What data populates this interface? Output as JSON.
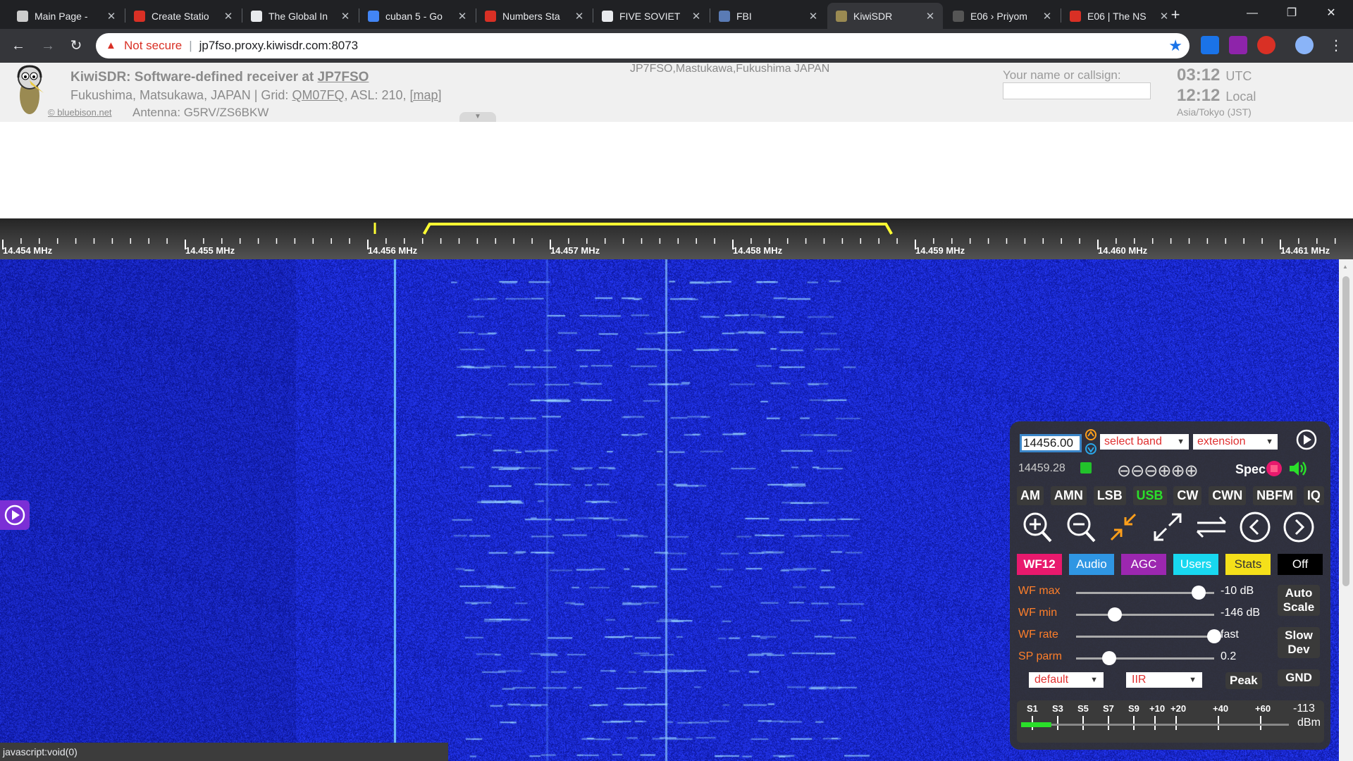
{
  "browser": {
    "tabs": [
      {
        "title": "Main Page - ",
        "icon": "wiki-icon"
      },
      {
        "title": "Create Statio",
        "icon": "numbers-station-icon"
      },
      {
        "title": "The Global In",
        "icon": "document-icon"
      },
      {
        "title": "cuban 5 - Go",
        "icon": "google-icon"
      },
      {
        "title": "Numbers Sta",
        "icon": "numbers-station-icon"
      },
      {
        "title": "FIVE SOVIET",
        "icon": "lock-icon"
      },
      {
        "title": "FBI",
        "icon": "fbi-seal-icon"
      },
      {
        "title": "KiwiSDR",
        "icon": "kiwi-icon",
        "active": true
      },
      {
        "title": "E06 › Priyom",
        "icon": "priyom-icon"
      },
      {
        "title": "E06 | The NS",
        "icon": "numbers-station-icon"
      }
    ],
    "not_secure_label": "Not secure",
    "url": "jp7fso.proxy.kiwisdr.com:8073",
    "status_text": "javascript:void(0)"
  },
  "kiwi": {
    "title_prefix": "KiwiSDR: Software-defined receiver at ",
    "title_callsign": "JP7FSO",
    "location_prefix": "Fukushima, Matsukawa, JAPAN | Grid: ",
    "grid": "QM07FQ",
    "asl_text": ", ASL: 210, ",
    "map_link": "[map]",
    "copyright": "© bluebison.net",
    "antenna": "Antenna: G5RV/ZS6BKW",
    "center_location": "JP7FSO,Mastukawa,Fukushima JAPAN",
    "callsign_label": "Your name or callsign:",
    "time_utc": "03:12",
    "utc_label": "UTC",
    "time_local": "12:12",
    "local_label": "Local",
    "timezone": "Asia/Tokyo (JST)"
  },
  "scale": {
    "labels": [
      "14.454 MHz",
      "14.455 MHz",
      "14.456 MHz",
      "14.457 MHz",
      "14.458 MHz",
      "14.459 MHz",
      "14.460 MHz",
      "14.461 MHz"
    ],
    "start_mhz": 14.454,
    "tuned_mhz": 14.456,
    "passband_mhz": [
      14.4563,
      14.4588
    ]
  },
  "panel": {
    "frequency": "14456.00",
    "band_select": "select band",
    "extension_select": "extension",
    "passband_freq": "14459.28",
    "zoom_symbols": "⊖⊖⊖⊕⊕⊕",
    "spec_label": "Spec",
    "modes": [
      "AM",
      "AMN",
      "LSB",
      "USB",
      "CW",
      "CWN",
      "NBFM",
      "IQ"
    ],
    "active_mode": "USB",
    "tabs": [
      {
        "label": "WF12",
        "bg": "#e8196d",
        "fg": "#ffffff"
      },
      {
        "label": "Audio",
        "bg": "#2f96e3",
        "fg": "#ffffff"
      },
      {
        "label": "AGC",
        "bg": "#9c27b0",
        "fg": "#ffffff"
      },
      {
        "label": "Users",
        "bg": "#18d8f0",
        "fg": "#ffffff"
      },
      {
        "label": "Stats",
        "bg": "#f5e01a",
        "fg": "#333333"
      },
      {
        "label": "Off",
        "bg": "#000000",
        "fg": "#ffffff"
      }
    ],
    "sliders": [
      {
        "label": "WF max",
        "value": "-10 dB",
        "level": 0.88
      },
      {
        "label": "WF min",
        "value": "-146 dB",
        "level": 0.24
      },
      {
        "label": "WF rate",
        "value": "fast",
        "level": 1.0
      },
      {
        "label": "SP parm",
        "value": "0.2",
        "level": 0.2
      }
    ],
    "auto_scale": "Auto\nScale",
    "slow_dev": "Slow\nDev",
    "gnd": "GND",
    "colormap_select": "default",
    "filter_select": "IIR",
    "peak": "Peak",
    "smeter_labels": [
      "S1",
      "S3",
      "S5",
      "S7",
      "S9",
      "+10",
      "+20",
      "+40",
      "+60"
    ],
    "signal_dbm": "-113",
    "dbm_unit": "dBm",
    "signal_level": 0.06
  },
  "colors": {
    "waterfall_bg": "#1a23c8",
    "passband": "#ffff33",
    "tuned_line": "#7fd8ff",
    "label_orange": "#ff7f2a"
  }
}
